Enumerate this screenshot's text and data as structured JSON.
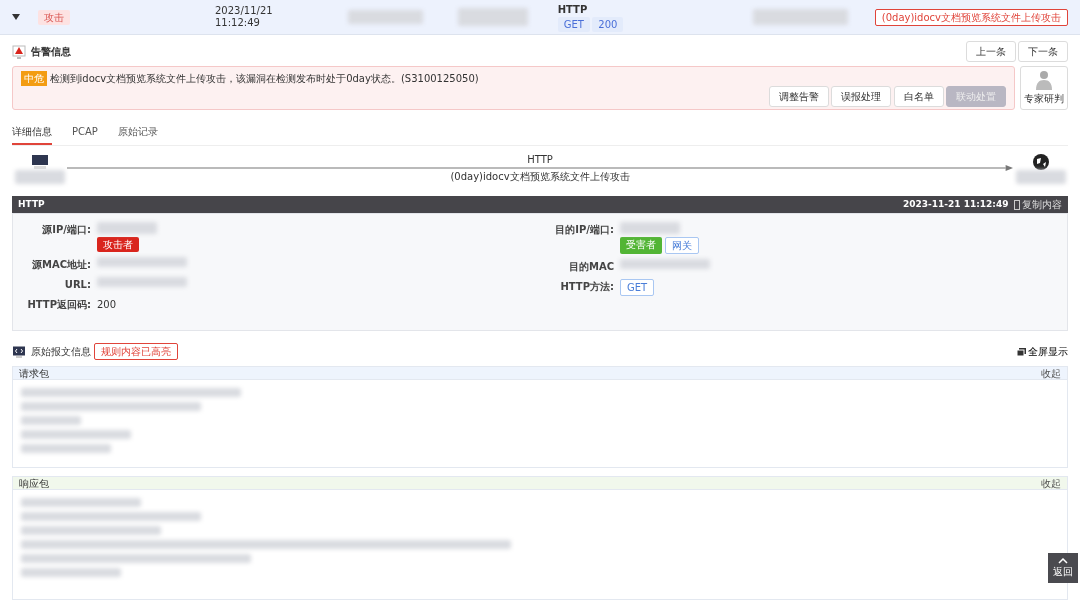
{
  "row": {
    "expanded": true,
    "type_tag": "攻击",
    "date": "2023/11/21",
    "time": "11:12:49",
    "protocol": "HTTP",
    "method": "GET",
    "code": "200",
    "event": "(0day)idocv文档预览系统文件上传攻击"
  },
  "alert": {
    "title": "告警信息",
    "nav": [
      "上一条",
      "下一条"
    ],
    "level": "中危",
    "message": "检测到idocv文档预览系统文件上传攻击，该漏洞在检测发布时处于0day状态。(S3100125050)",
    "actions": [
      {
        "label": "调整告警",
        "disabled": false
      },
      {
        "label": "误报处理",
        "disabled": false
      },
      {
        "label": "白名单",
        "disabled": false
      },
      {
        "label": "联动处置",
        "disabled": true
      }
    ],
    "expert": "专家研判"
  },
  "tabs": [
    {
      "label": "详细信息",
      "selected": true
    },
    {
      "label": "PCAP",
      "selected": false
    },
    {
      "label": "原始记录",
      "selected": false
    }
  ],
  "flow": {
    "protocol": "HTTP",
    "event": "(0day)idocv文档预览系统文件上传攻击"
  },
  "detail": {
    "title": "HTTP",
    "time": "2023-11-21 11:12:49",
    "copy": "复制内容",
    "left": [
      {
        "label": "源IP/端口:",
        "kind": "ip",
        "tags": [
          {
            "text": "攻击者",
            "kind": "danger"
          }
        ]
      },
      {
        "label": "源MAC地址:",
        "kind": "redacted"
      },
      {
        "label": "URL:",
        "kind": "redacted"
      },
      {
        "label": "HTTP返回码:",
        "kind": "text",
        "value": "200"
      }
    ],
    "right": [
      {
        "label": "目的IP/端口:",
        "kind": "ip",
        "tags": [
          {
            "text": "受害者",
            "kind": "success"
          },
          {
            "text": "网关",
            "kind": "outline"
          }
        ]
      },
      {
        "label": "目的MAC",
        "kind": "redacted"
      },
      {
        "label": "HTTP方法:",
        "kind": "tag",
        "value": "GET"
      }
    ]
  },
  "raw": {
    "title": "原始报文信息",
    "tag": "规则内容已高亮",
    "fullscreen": "全屏显示",
    "panels": [
      {
        "title": "请求包",
        "toggle": "收起",
        "kind": "request"
      },
      {
        "title": "响应包",
        "toggle": "收起",
        "kind": "response"
      }
    ]
  },
  "back": "返回"
}
